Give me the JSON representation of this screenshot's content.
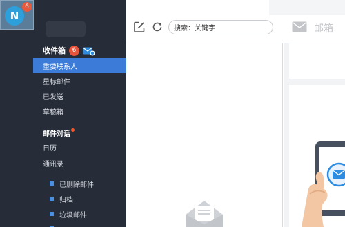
{
  "account": {
    "avatar_letter": "N",
    "badge_count": "6"
  },
  "sidebar": {
    "inbox": {
      "label": "收件箱",
      "count": "6"
    },
    "items": [
      {
        "label": "重要联系人",
        "active": true
      },
      {
        "label": "星标邮件",
        "active": false
      },
      {
        "label": "已发送",
        "active": false
      },
      {
        "label": "草稿箱",
        "active": false
      }
    ],
    "conversations_label": "邮件对话",
    "items2": [
      {
        "label": "日历"
      },
      {
        "label": "通讯录"
      }
    ],
    "folders": [
      {
        "label": "已删除邮件"
      },
      {
        "label": "归档"
      },
      {
        "label": "垃圾邮件"
      }
    ]
  },
  "toolbar": {
    "search_label": "搜索：关键字",
    "mailbox_label": "邮箱"
  },
  "colors": {
    "sidebar_bg": "#262c38",
    "active_item": "#3d7bd8",
    "badge": "#e8553c",
    "accent": "#2da0dc"
  }
}
